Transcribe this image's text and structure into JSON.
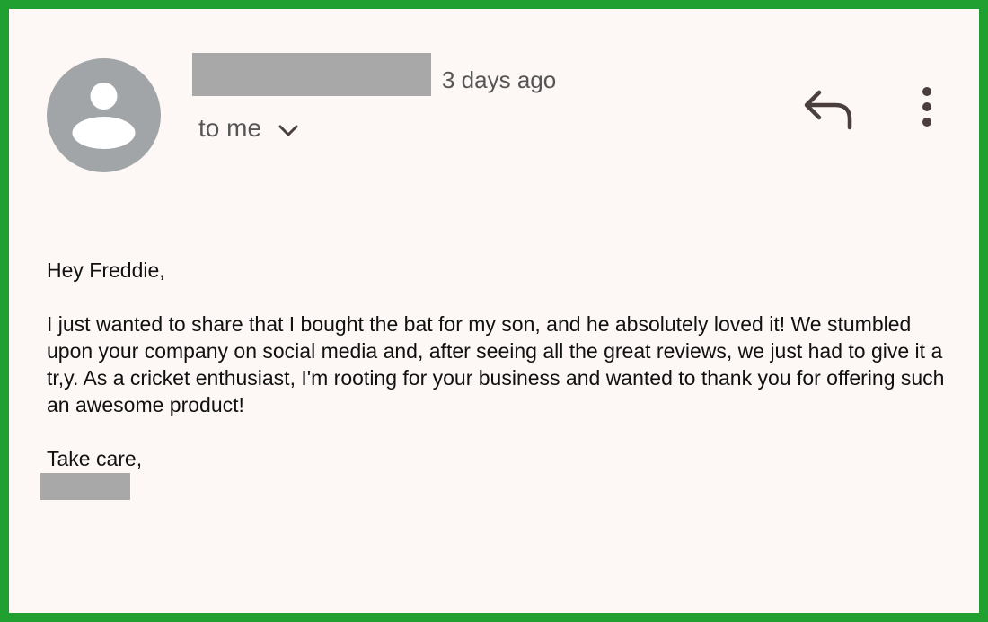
{
  "email": {
    "timestamp": "3 days ago",
    "recipients_label": "to me",
    "greeting": "Hey Freddie,",
    "body": "I just wanted to share that I bought the bat for my son, and he absolutely loved it! We stumbled upon your company on social media and, after seeing all the great reviews, we just had to give it a tr,y. As a cricket enthusiast, I'm rooting for your business and wanted to thank you for offering such an awesome product!",
    "closing": "Take care,"
  },
  "icons": {
    "avatar": "person-avatar-icon",
    "expand": "chevron-down-icon",
    "reply": "reply-icon",
    "more": "more-vert-icon"
  },
  "colors": {
    "frame_border": "#21a032",
    "background": "#fdf7f5",
    "avatar": "#a2a5a7",
    "redaction": "#a8a8a8",
    "secondary_text": "#555555",
    "icon": "#4a3f3c"
  }
}
